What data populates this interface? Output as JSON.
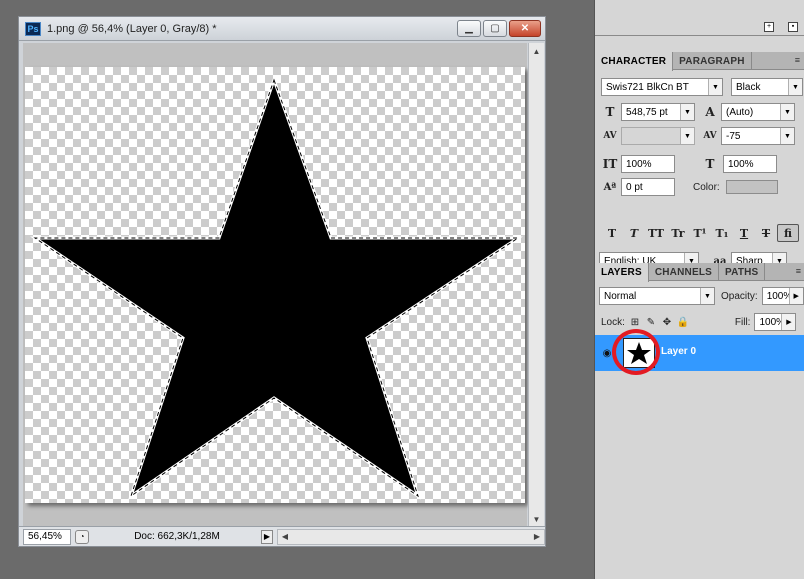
{
  "document": {
    "app_icon": "Ps",
    "title": "1.png @ 56,4% (Layer 0, Gray/8) *",
    "zoom": "56,45%",
    "doc_info": "Doc: 662,3K/1,28M"
  },
  "character_panel": {
    "tabs": [
      "CHARACTER",
      "PARAGRAPH"
    ],
    "font_family": "Swis721 BlkCn BT",
    "font_style": "Black",
    "font_size": "548,75 pt",
    "leading": "(Auto)",
    "kerning": "",
    "tracking": "-75",
    "vertical_scale": "100%",
    "horizontal_scale": "100%",
    "baseline_shift": "0 pt",
    "color_label": "Color:",
    "style_buttons": [
      "T",
      "T",
      "TT",
      "Tr",
      "T¹",
      "T₁",
      "T",
      "T",
      "fi"
    ],
    "language": "English: UK",
    "aa_icon": "aa",
    "antialias": "Sharp"
  },
  "layers_panel": {
    "tabs": [
      "LAYERS",
      "CHANNELS",
      "PATHS"
    ],
    "blend_mode": "Normal",
    "opacity_label": "Opacity:",
    "opacity": "100%",
    "lock_label": "Lock:",
    "fill_label": "Fill:",
    "fill": "100%",
    "layers": [
      {
        "name": "Layer 0",
        "visible": true,
        "selected": true
      }
    ]
  },
  "colors": {
    "selection": "#3399ff",
    "highlight_circle": "#e31b23"
  }
}
